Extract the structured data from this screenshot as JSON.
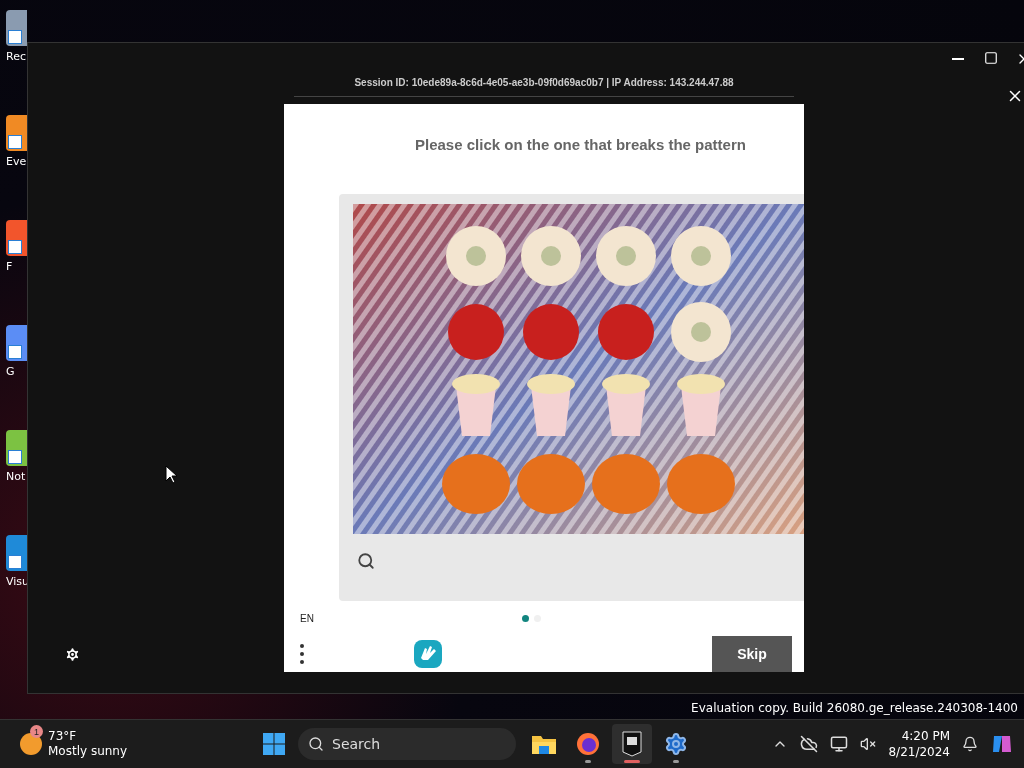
{
  "desktop": {
    "icons": [
      {
        "label": "Rec",
        "color": "#8a9bb0"
      },
      {
        "label": "Eve",
        "color": "#f08a24"
      },
      {
        "label": "F",
        "color": "#f2552c"
      },
      {
        "label": "G",
        "color": "#5b8df5"
      },
      {
        "label": "Not",
        "color": "#7cc242"
      },
      {
        "label": "Visu",
        "color": "#1f8ad8"
      }
    ],
    "watermark": "Evaluation copy. Build 26080.ge_release.240308-1400"
  },
  "window": {
    "session_info": "Session ID: 10ede89a-8c6d-4e05-ae3b-09f0d69ac0b7 | IP Address: 143.244.47.88"
  },
  "captcha": {
    "prompt": "Please click on the one that breaks the pattern",
    "language": "EN",
    "pages": [
      {
        "selected": true
      },
      {
        "selected": false
      }
    ],
    "skip_button": "Skip"
  },
  "taskbar": {
    "weather": {
      "temperature": "73°F",
      "condition": "Mostly sunny",
      "badge": "1"
    },
    "search": {
      "placeholder": "Search"
    },
    "apps": [
      {
        "kind": "explorer",
        "running": false,
        "selected": false
      },
      {
        "kind": "firefox",
        "running": true,
        "selected": false
      },
      {
        "kind": "epic",
        "running": true,
        "selected": true
      },
      {
        "kind": "settings",
        "running": true,
        "selected": false
      }
    ],
    "clock": {
      "time": "4:20 PM",
      "date": "8/21/2024"
    }
  }
}
